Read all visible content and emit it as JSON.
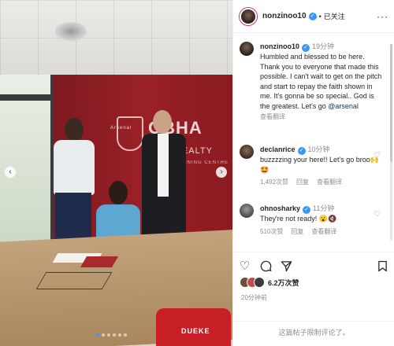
{
  "post": {
    "username": "nonzinoo10",
    "follow_separator": "•",
    "follow_state": "已关注",
    "more": "···"
  },
  "photo": {
    "wall_brand": "OBHA",
    "wall_sub": "REALTY",
    "wall_caption": "TRAINING CENTRE",
    "crest_text": "Arsenal",
    "shirt_text": "DUEKE",
    "slides": 6,
    "active_slide": 0,
    "prev_icon": "chevron-left-icon",
    "next_icon": "chevron-right-icon"
  },
  "caption": {
    "username": "nonzinoo10",
    "time": "19分钟",
    "text": "Humbled and blessed to be here. Thank you to everyone that made this possible. I can't wait to get on the pitch and start to repay the faith shown in me. It's gonna be so special.. God is the greatest. Let's go ",
    "mention": "@arsenal",
    "translate": "查看翻译"
  },
  "comments": [
    {
      "username": "declanrice",
      "time": "10分钟",
      "text": "buzzzzing your here!! Let's go broo🙌🤩",
      "likes": "1,492次赞",
      "reply": "回复",
      "translate": "查看翻译"
    },
    {
      "username": "ohnosharky",
      "time": "11分钟",
      "text": "They're not ready! 😮🔇",
      "likes": "510次赞",
      "reply": "回复",
      "translate": "查看翻译"
    }
  ],
  "actions": {
    "like_icon": "heart-icon",
    "comment_icon": "comment-icon",
    "share_icon": "send-icon",
    "save_icon": "bookmark-icon"
  },
  "likes_summary": "6.2万次赞",
  "posted_ago": "20分钟前",
  "comments_closed": "这篇帖子限制评论了。",
  "colors": {
    "accent": "#3897f0",
    "wall": "#9a2027",
    "muted": "#8e8e8e"
  }
}
